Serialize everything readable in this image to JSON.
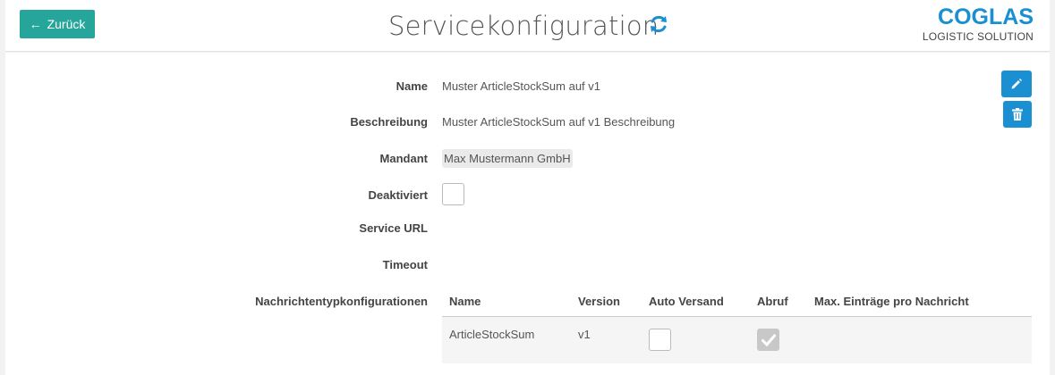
{
  "header": {
    "back_label": "Zurück",
    "title": "Servicekonfiguration",
    "logo_main": "COGLAS",
    "logo_sub": "LOGISTIC SOLUTION"
  },
  "form": {
    "name_label": "Name",
    "name_value": "Muster ArticleStockSum auf v1",
    "description_label": "Beschreibung",
    "description_value": "Muster ArticleStockSum auf v1 Beschreibung",
    "client_label": "Mandant",
    "client_value": "Max Mustermann GmbH",
    "disabled_label": "Deaktiviert",
    "disabled_checked": false,
    "service_url_label": "Service URL",
    "service_url_value": "",
    "timeout_label": "Timeout",
    "timeout_value": "",
    "message_type_label": "Nachrichtentypkonfigurationen"
  },
  "message_table": {
    "columns": [
      "Name",
      "Version",
      "Auto Versand",
      "Abruf",
      "Max. Einträge pro Nachricht"
    ],
    "rows": [
      {
        "name": "ArticleStockSum",
        "version": "v1",
        "auto_send": false,
        "fetch": true,
        "max_entries": ""
      }
    ]
  },
  "colors": {
    "accent": "#1a8fd1",
    "back_button": "#26a69a"
  },
  "icons": {
    "back": "arrow-left-icon",
    "refresh": "refresh-icon",
    "edit": "pencil-icon",
    "delete": "trash-icon",
    "check": "checkmark-icon"
  }
}
